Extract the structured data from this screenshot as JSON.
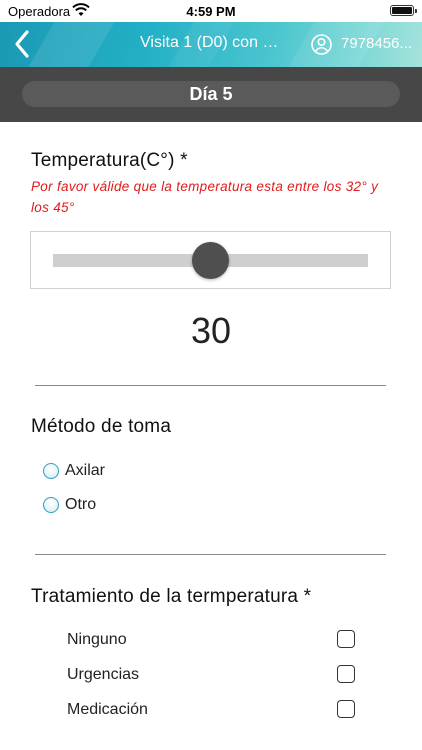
{
  "status_bar": {
    "carrier": "Operadora",
    "time": "4:59 PM"
  },
  "nav": {
    "title": "Visita 1 (D0) con …",
    "user_id": "7978456...",
    "back_icon": "chevron-left-icon",
    "user_icon": "user-circle-icon"
  },
  "day_header": {
    "label": "Día 5"
  },
  "temperature": {
    "title": "Temperatura(C°) *",
    "warning": "Por favor válide que la temperatura esta entre los 32° y los 45°",
    "value": "30",
    "slider_fraction": 0.5
  },
  "method": {
    "title": "Método de toma",
    "options": [
      {
        "label": "Axilar",
        "selected": false
      },
      {
        "label": "Otro",
        "selected": false
      }
    ]
  },
  "treatment": {
    "title": "Tratamiento de la termperatura *",
    "options": [
      {
        "label": "Ninguno",
        "checked": false
      },
      {
        "label": "Urgencias",
        "checked": false
      },
      {
        "label": "Medicación",
        "checked": false
      }
    ]
  },
  "colors": {
    "nav_gradient_start": "#1b99b4",
    "nav_gradient_end": "#a6e2dc",
    "day_header_bg": "#474747",
    "warning_text": "#e21b1b",
    "radio_border": "#2f9fbf"
  }
}
